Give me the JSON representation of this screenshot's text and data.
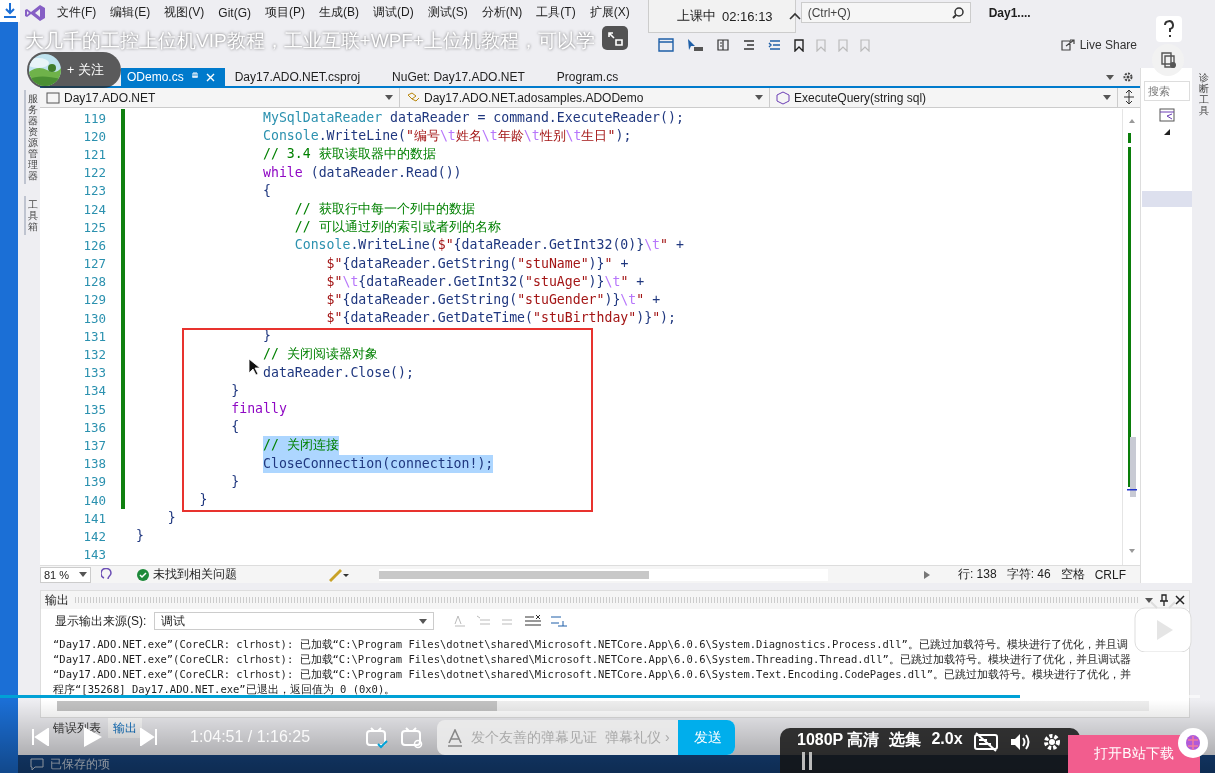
{
  "video_title": "大几千的工控上位机VIP教程，工业互联+WPF+上位机教程，可以学",
  "follow_button": "+ 关注",
  "live_badge": {
    "label": "上课中",
    "time": "02:16:13"
  },
  "menu": [
    "文件(F)",
    "编辑(E)",
    "视图(V)",
    "Git(G)",
    "项目(P)",
    "生成(B)",
    "调试(D)",
    "测试(S)",
    "分析(N)",
    "工具(T)",
    "扩展(X)"
  ],
  "search": {
    "placeholder": "(Ctrl+Q)"
  },
  "window_title": "Day1....",
  "live_share": "Live Share",
  "left_tool_tabs": [
    "服务器资源管理器",
    "工具箱"
  ],
  "right_tool_tab": "诊断工具",
  "search_panel": {
    "label": "搜索"
  },
  "tabs": [
    {
      "label": "ODemo.cs",
      "selected": true
    },
    {
      "label": "Day17.ADO.NET.csproj",
      "selected": false
    },
    {
      "label": "NuGet: Day17.ADO.NET",
      "selected": false
    },
    {
      "label": "Program.cs",
      "selected": false
    }
  ],
  "navigation": [
    "Day17.ADO.NET",
    "Day17.ADO.NET.adosamples.ADODemo",
    "ExecuteQuery(string sql)"
  ],
  "code_lines": [
    {
      "number": "119",
      "changed": true,
      "selected": false,
      "segments": [
        {
          "kind": "type",
          "text": "                MySqlDataReader"
        },
        {
          "kind": "plain",
          "text": " dataReader = command.ExecuteReader();"
        }
      ]
    },
    {
      "number": "120",
      "changed": true,
      "selected": false,
      "segments": [
        {
          "kind": "type",
          "text": "                Console"
        },
        {
          "kind": "plain",
          "text": ".WriteLine("
        },
        {
          "kind": "string",
          "text": "\"编号"
        },
        {
          "kind": "escape",
          "text": "\\t"
        },
        {
          "kind": "string",
          "text": "姓名"
        },
        {
          "kind": "escape",
          "text": "\\t"
        },
        {
          "kind": "string",
          "text": "年龄"
        },
        {
          "kind": "escape",
          "text": "\\t"
        },
        {
          "kind": "string",
          "text": "性别"
        },
        {
          "kind": "escape",
          "text": "\\t"
        },
        {
          "kind": "string",
          "text": "生日\""
        },
        {
          "kind": "plain",
          "text": ");"
        }
      ]
    },
    {
      "number": "121",
      "changed": true,
      "selected": false,
      "segments": [
        {
          "kind": "comment",
          "text": "                // 3.4 获取读取器中的数据"
        }
      ]
    },
    {
      "number": "122",
      "changed": true,
      "selected": false,
      "segments": [
        {
          "kind": "keyword",
          "text": "                while"
        },
        {
          "kind": "plain",
          "text": " (dataReader.Read())"
        }
      ]
    },
    {
      "number": "123",
      "changed": true,
      "selected": false,
      "segments": [
        {
          "kind": "plain",
          "text": "                {"
        }
      ]
    },
    {
      "number": "124",
      "changed": true,
      "selected": false,
      "segments": [
        {
          "kind": "comment",
          "text": "                    // 获取行中每一个列中的数据"
        }
      ]
    },
    {
      "number": "125",
      "changed": true,
      "selected": false,
      "segments": [
        {
          "kind": "comment",
          "text": "                    // 可以通过列的索引或者列的名称"
        }
      ]
    },
    {
      "number": "126",
      "changed": true,
      "selected": false,
      "segments": [
        {
          "kind": "type",
          "text": "                    Console"
        },
        {
          "kind": "plain",
          "text": ".WriteLine("
        },
        {
          "kind": "string",
          "text": "$\""
        },
        {
          "kind": "plain",
          "text": "{dataReader.GetInt32(0)}"
        },
        {
          "kind": "escape",
          "text": "\\t"
        },
        {
          "kind": "string",
          "text": "\""
        },
        {
          "kind": "plain",
          "text": " +"
        }
      ]
    },
    {
      "number": "127",
      "changed": true,
      "selected": false,
      "segments": [
        {
          "kind": "string",
          "text": "                        $\""
        },
        {
          "kind": "plain",
          "text": "{dataReader.GetString("
        },
        {
          "kind": "string",
          "text": "\"stuName\""
        },
        {
          "kind": "plain",
          "text": ")}"
        },
        {
          "kind": "string",
          "text": "\""
        },
        {
          "kind": "plain",
          "text": " +"
        }
      ]
    },
    {
      "number": "128",
      "changed": true,
      "selected": false,
      "segments": [
        {
          "kind": "string",
          "text": "                        $\""
        },
        {
          "kind": "escape",
          "text": "\\t"
        },
        {
          "kind": "plain",
          "text": "{dataReader.GetInt32("
        },
        {
          "kind": "string",
          "text": "\"stuAge\""
        },
        {
          "kind": "plain",
          "text": ")}"
        },
        {
          "kind": "escape",
          "text": "\\t"
        },
        {
          "kind": "string",
          "text": "\""
        },
        {
          "kind": "plain",
          "text": " +"
        }
      ]
    },
    {
      "number": "129",
      "changed": true,
      "selected": false,
      "segments": [
        {
          "kind": "string",
          "text": "                        $\""
        },
        {
          "kind": "plain",
          "text": "{dataReader.GetString("
        },
        {
          "kind": "string",
          "text": "\"stuGender\""
        },
        {
          "kind": "plain",
          "text": ")}"
        },
        {
          "kind": "escape",
          "text": "\\t"
        },
        {
          "kind": "string",
          "text": "\""
        },
        {
          "kind": "plain",
          "text": " +"
        }
      ]
    },
    {
      "number": "130",
      "changed": true,
      "selected": false,
      "segments": [
        {
          "kind": "string",
          "text": "                        $\""
        },
        {
          "kind": "plain",
          "text": "{dataReader.GetDateTime("
        },
        {
          "kind": "string",
          "text": "\"stuBirthday\""
        },
        {
          "kind": "plain",
          "text": ")}"
        },
        {
          "kind": "string",
          "text": "\""
        },
        {
          "kind": "plain",
          "text": ");"
        }
      ]
    },
    {
      "number": "131",
      "changed": true,
      "selected": false,
      "segments": [
        {
          "kind": "plain",
          "text": "                }"
        }
      ]
    },
    {
      "number": "132",
      "changed": true,
      "selected": false,
      "segments": [
        {
          "kind": "comment",
          "text": "                // 关闭阅读器对象"
        }
      ]
    },
    {
      "number": "133",
      "changed": true,
      "selected": false,
      "segments": [
        {
          "kind": "plain",
          "text": "                dataReader.Close();"
        }
      ]
    },
    {
      "number": "134",
      "changed": true,
      "selected": false,
      "segments": [
        {
          "kind": "plain",
          "text": "            }"
        }
      ]
    },
    {
      "number": "135",
      "changed": true,
      "selected": false,
      "segments": [
        {
          "kind": "keyword",
          "text": "            finally"
        }
      ]
    },
    {
      "number": "136",
      "changed": true,
      "selected": false,
      "segments": [
        {
          "kind": "plain",
          "text": "            {"
        }
      ]
    },
    {
      "number": "137",
      "changed": true,
      "selected": true,
      "segments": [
        {
          "kind": "comment",
          "text": "                // 关闭连接"
        }
      ]
    },
    {
      "number": "138",
      "changed": true,
      "selected": true,
      "segments": [
        {
          "kind": "plain",
          "text": "                CloseConnection(connection!);"
        }
      ]
    },
    {
      "number": "139",
      "changed": true,
      "selected": false,
      "segments": [
        {
          "kind": "plain",
          "text": "            }"
        }
      ]
    },
    {
      "number": "140",
      "changed": true,
      "selected": false,
      "segments": [
        {
          "kind": "plain",
          "text": "        }"
        }
      ]
    },
    {
      "number": "141",
      "changed": false,
      "selected": false,
      "segments": [
        {
          "kind": "plain",
          "text": "    }"
        }
      ]
    },
    {
      "number": "142",
      "changed": false,
      "selected": false,
      "segments": [
        {
          "kind": "plain",
          "text": "}"
        }
      ]
    },
    {
      "number": "143",
      "changed": false
    }
  ],
  "editor_status": {
    "zoom": "81 %",
    "issues": "未找到相关问题",
    "line": "行: 138",
    "column": "字符: 46",
    "indent": "空格",
    "line_ending": "CRLF"
  },
  "output": {
    "title": "输出",
    "source_label": "显示输出来源(S):",
    "source": "调试",
    "lines": [
      "“Day17.ADO.NET.exe”(CoreCLR: clrhost): 已加载“C:\\Program Files\\dotnet\\shared\\Microsoft.NETCore.App\\6.0.6\\System.Diagnostics.Process.dll”。已跳过加载符号。模块进行了优化，并且调",
      "“Day17.ADO.NET.exe”(CoreCLR: clrhost): 已加载“C:\\Program Files\\dotnet\\shared\\Microsoft.NETCore.App\\6.0.6\\System.Threading.Thread.dll”。已跳过加载符号。模块进行了优化，并且调试器",
      "“Day17.ADO.NET.exe”(CoreCLR: clrhost): 已加载“C:\\Program Files\\dotnet\\shared\\Microsoft.NETCore.App\\6.0.6\\System.Text.Encoding.CodePages.dll”。已跳过加载符号。模块进行了优化，并",
      "程序“[35268] Day17.ADO.NET.exe”已退出，返回值为 0 (0x0)。"
    ]
  },
  "bottom_tabs": [
    {
      "label": "错误列表",
      "selected": false
    },
    {
      "label": "输出",
      "selected": true
    }
  ],
  "status_bar": "已保存的项",
  "player": {
    "progress": {
      "level": 0.85
    },
    "time": "1:04:51 / 1:16:25",
    "danmaku_placeholder": "发个友善的弹幕见证",
    "etiquette_link": "弹幕礼仪 ›",
    "send_button": "发送",
    "quality": "1080P 高清",
    "episodes": "选集",
    "speed": "2.0x",
    "download_button": "打开B站下载"
  }
}
